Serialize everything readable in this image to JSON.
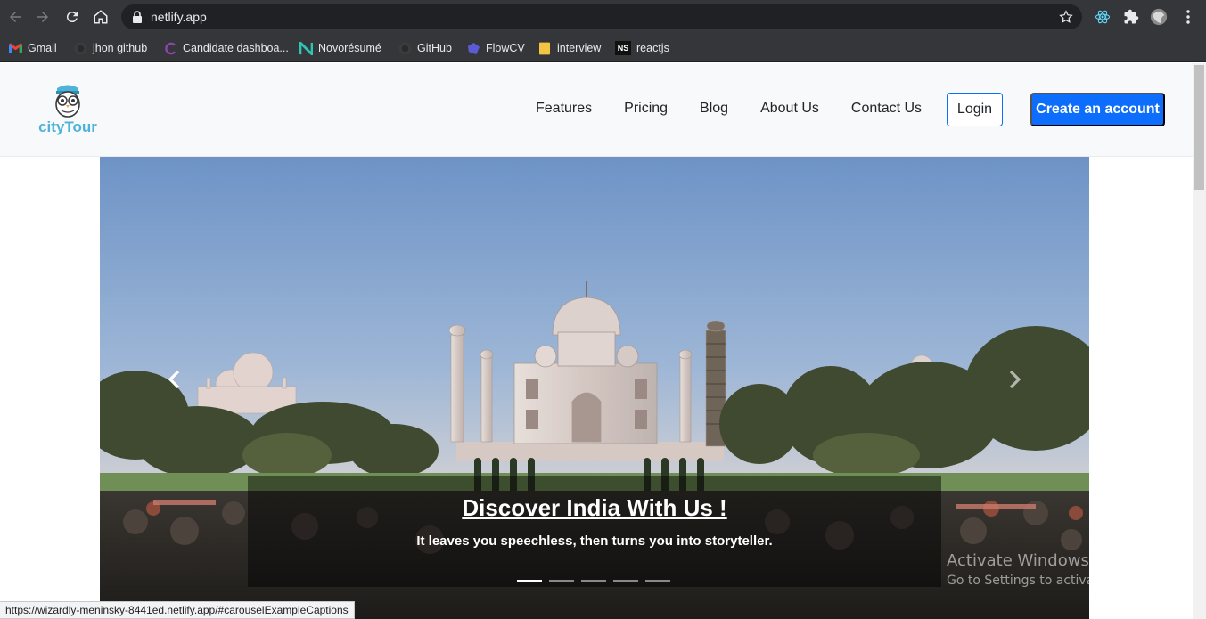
{
  "browser": {
    "url": "netlify.app",
    "bookmarks": [
      {
        "label": "Gmail",
        "icon": "gmail-icon"
      },
      {
        "label": "jhon github",
        "icon": "github-icon"
      },
      {
        "label": "Candidate dashboa...",
        "icon": "candidate-icon"
      },
      {
        "label": "Novorésumé",
        "icon": "novoresume-icon"
      },
      {
        "label": "GitHub",
        "icon": "github-icon"
      },
      {
        "label": "FlowCV",
        "icon": "flowcv-icon"
      },
      {
        "label": "interview",
        "icon": "folder-icon"
      },
      {
        "label": "reactjs",
        "icon": "ns-icon",
        "icon_text": "NS"
      }
    ],
    "status_url": "https://wizardly-meninsky-8441ed.netlify.app/#carouselExampleCaptions"
  },
  "site": {
    "brand": "cityTour",
    "nav": [
      "Features",
      "Pricing",
      "Blog",
      "About Us",
      "Contact Us"
    ],
    "login_label": "Login",
    "create_account_label": "Create an account",
    "accent_color": "#0d6efd",
    "brand_color": "#4fb3d9"
  },
  "carousel": {
    "title": "Discover India With Us !",
    "subtitle": "It leaves you speechless, then turns you into storyteller.",
    "slide_count": 5,
    "active_index": 0
  },
  "os_watermark": {
    "line1": "Activate Windows",
    "line2": "Go to Settings to activate Windows."
  }
}
